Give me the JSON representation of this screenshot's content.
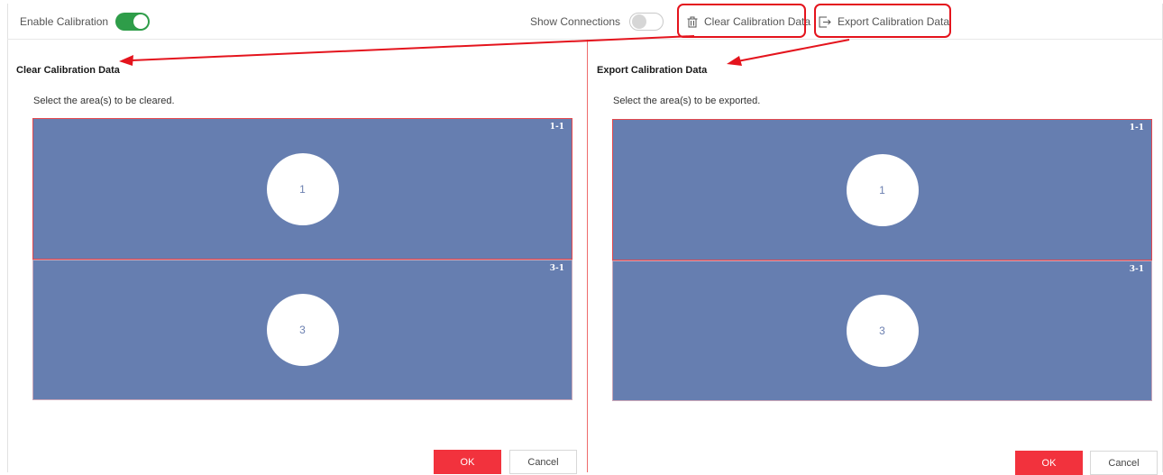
{
  "toolbar": {
    "enable_calibration_label": "Enable Calibration",
    "enable_calibration_on": true,
    "show_connections_label": "Show Connections",
    "show_connections_on": false,
    "clear_button_label": "Clear Calibration Data",
    "export_button_label": "Export Calibration Data"
  },
  "clear_panel": {
    "title": "Clear Calibration Data",
    "hint": "Select the area(s) to be cleared.",
    "areas": [
      {
        "tag": "1-1",
        "number": "1"
      },
      {
        "tag": "3-1",
        "number": "3"
      }
    ],
    "ok_label": "OK",
    "cancel_label": "Cancel"
  },
  "export_panel": {
    "title": "Export Calibration Data",
    "hint": "Select the area(s) to be exported.",
    "areas": [
      {
        "tag": "1-1",
        "number": "1"
      },
      {
        "tag": "3-1",
        "number": "3"
      }
    ],
    "ok_label": "OK",
    "cancel_label": "Cancel"
  },
  "colors": {
    "accent_red": "#e4141d",
    "switch_on": "#2e9d49",
    "area_fill": "#667eb0",
    "ok_button": "#f2323d"
  },
  "icons": {
    "clear": "trash-icon",
    "export": "export-icon"
  }
}
